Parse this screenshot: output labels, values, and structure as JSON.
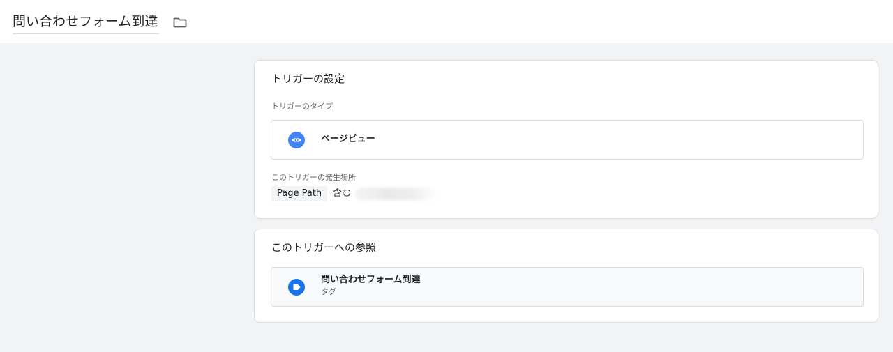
{
  "header": {
    "title": "問い合わせフォーム到達",
    "folder_icon": "folder-icon"
  },
  "trigger_config": {
    "title": "トリガーの設定",
    "type_label": "トリガーのタイプ",
    "type": {
      "name": "ページビュー",
      "icon": "eye-icon",
      "icon_color": "#4285f4"
    },
    "where_label": "このトリガーの発生場所",
    "condition": {
      "variable": "Page Path",
      "operator": "含む"
    }
  },
  "references": {
    "title": "このトリガーへの参照",
    "items": [
      {
        "name": "問い合わせフォーム到達",
        "type": "タグ",
        "icon": "tag-icon",
        "icon_color": "#1a73e8"
      }
    ]
  }
}
